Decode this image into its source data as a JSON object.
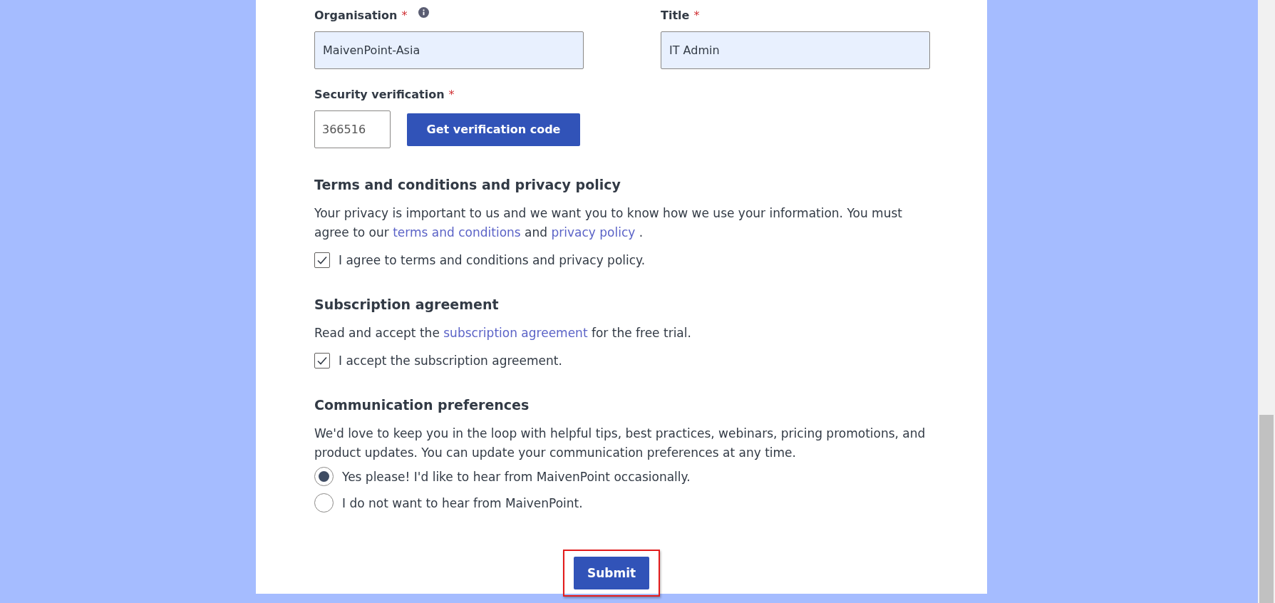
{
  "fields": [
    {
      "label": "Organisation",
      "required_mark": "*",
      "info": true,
      "value": "MaivenPoint-Asia"
    },
    {
      "label": "Title",
      "required_mark": "*",
      "value": "IT Admin"
    }
  ],
  "security": {
    "label": "Security verification",
    "required_mark": "*",
    "value": "366516",
    "button": "Get verification code"
  },
  "sections": [
    {
      "kind": "checkbox",
      "heading": "Terms and conditions and privacy policy",
      "text": [
        {
          "t": "Your privacy is important to us and we want you to know how we use your information. You must agree to our "
        },
        {
          "link": "terms and conditions"
        },
        {
          "t": " and "
        },
        {
          "link": "privacy policy"
        },
        {
          "t": " ."
        }
      ],
      "options": [
        {
          "label": "I agree to terms and conditions and privacy policy.",
          "checked": true
        }
      ]
    },
    {
      "kind": "checkbox",
      "heading": "Subscription agreement",
      "text": [
        {
          "t": "Read and accept the "
        },
        {
          "link": "subscription agreement"
        },
        {
          "t": " for the free trial."
        }
      ],
      "options": [
        {
          "label": "I accept the subscription agreement.",
          "checked": true
        }
      ]
    },
    {
      "kind": "radio",
      "heading": "Communication preferences",
      "text": [
        {
          "t": "We'd love to keep you in the loop with helpful tips, best practices, webinars, pricing promotions, and product updates. You can update your communication preferences at any time."
        }
      ],
      "options": [
        {
          "label": "Yes please! I'd like to hear from MaivenPoint occasionally.",
          "selected": true
        },
        {
          "label": "I do not want to hear from MaivenPoint.",
          "selected": false
        }
      ]
    }
  ],
  "submit": {
    "label": "Submit",
    "highlighted": true
  }
}
